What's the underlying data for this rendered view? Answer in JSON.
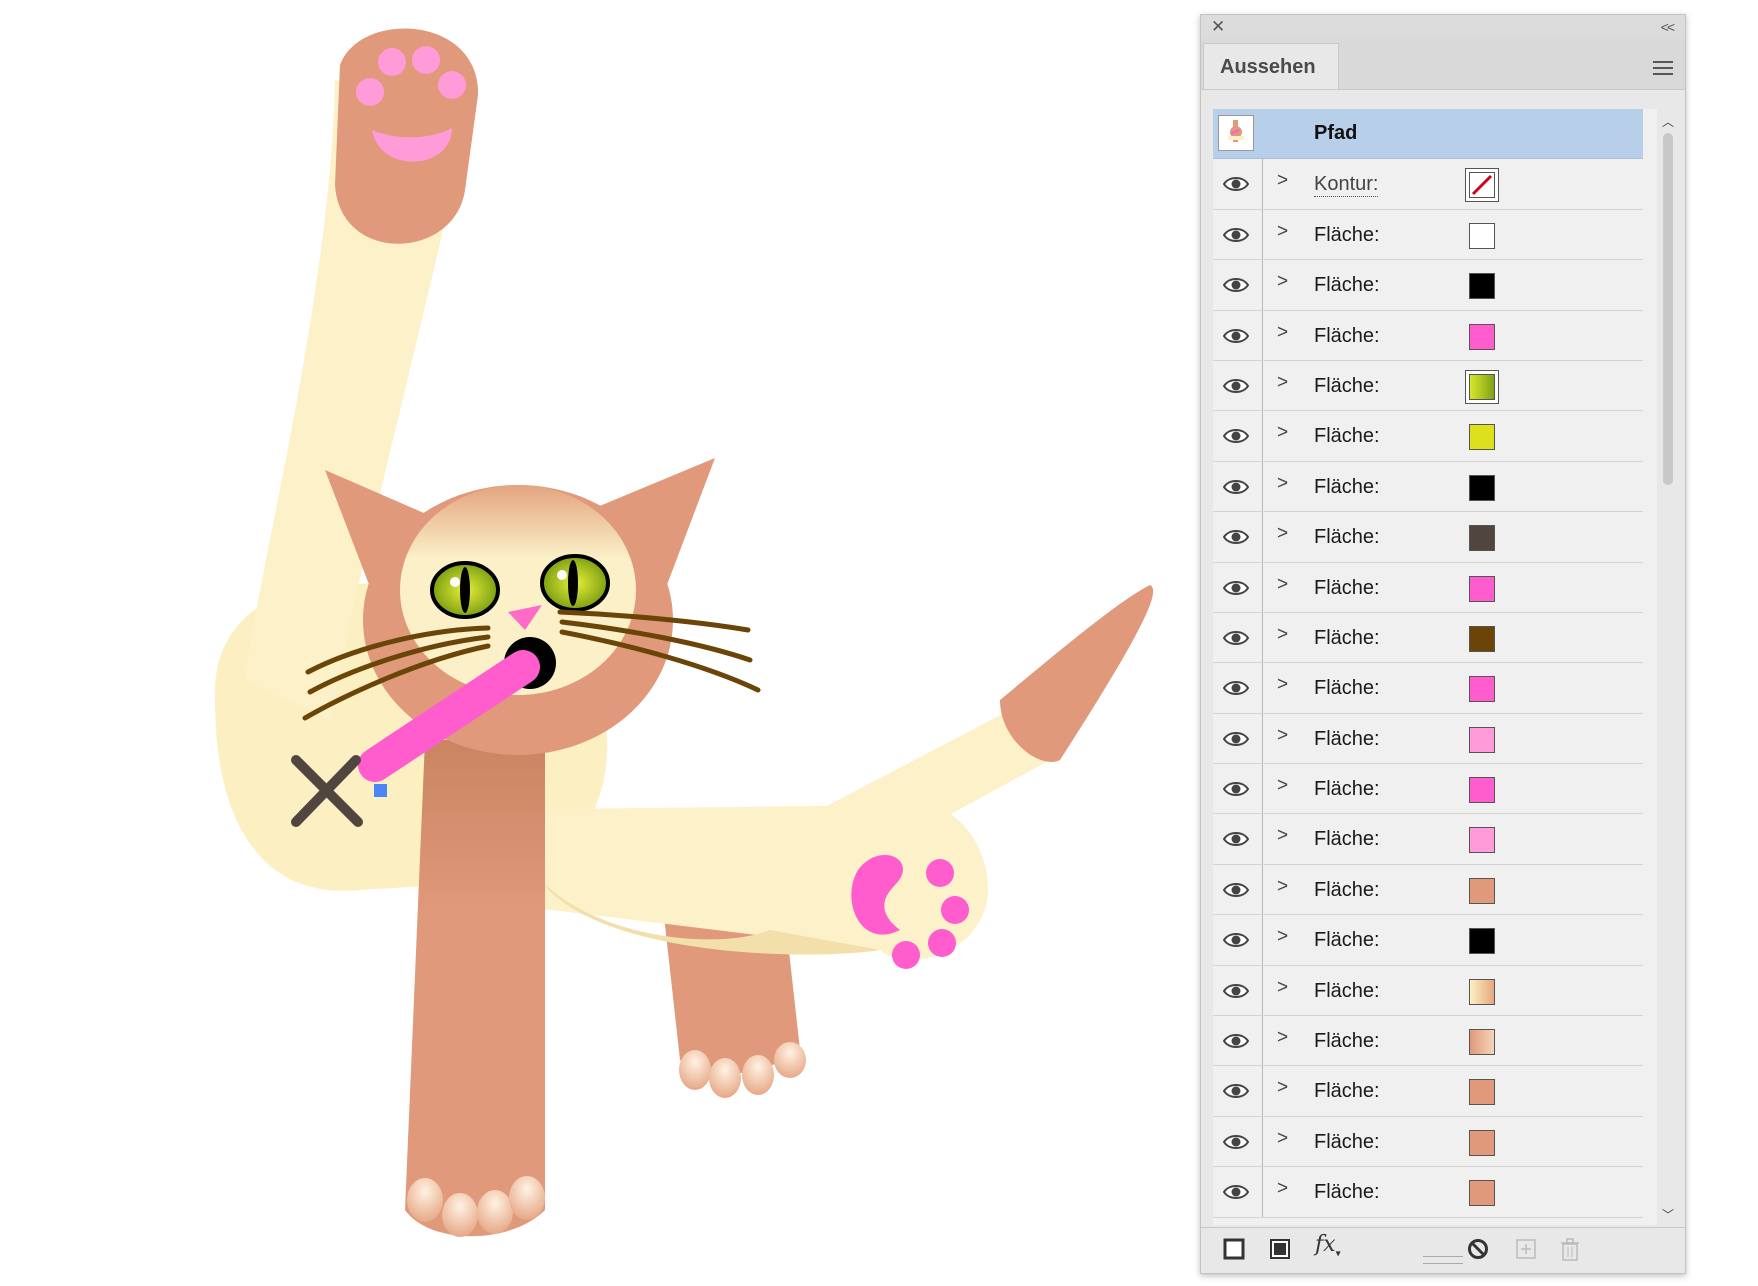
{
  "panel": {
    "tab_label": "Aussehen",
    "header_label": "Pfad",
    "stroke_label": "Kontur:",
    "rows": [
      {
        "label": "Fläche:",
        "color": "#ffffff"
      },
      {
        "label": "Fläche:",
        "color": "#000000"
      },
      {
        "label": "Fläche:",
        "color": "#ff5ccd"
      },
      {
        "label": "Fläche:",
        "color": "linear-gradient(90deg,#d8e62a,#7fa316)",
        "framed": true
      },
      {
        "label": "Fläche:",
        "color": "#dde01c"
      },
      {
        "label": "Fläche:",
        "color": "#000000"
      },
      {
        "label": "Fläche:",
        "color": "#50463f"
      },
      {
        "label": "Fläche:",
        "color": "#ff5ccd"
      },
      {
        "label": "Fläche:",
        "color": "#6b4508"
      },
      {
        "label": "Fläche:",
        "color": "#ff5ccd"
      },
      {
        "label": "Fläche:",
        "color": "#ff9bd9"
      },
      {
        "label": "Fläche:",
        "color": "#ff5ccd"
      },
      {
        "label": "Fläche:",
        "color": "#ff9bd9"
      },
      {
        "label": "Fläche:",
        "color": "#e0997a"
      },
      {
        "label": "Fläche:",
        "color": "#000000"
      },
      {
        "label": "Fläche:",
        "color": "linear-gradient(90deg,#fdf0c4,#e6a77f)"
      },
      {
        "label": "Fläche:",
        "color": "linear-gradient(90deg,#e0997a,#f5d4b8)"
      },
      {
        "label": "Fläche:",
        "color": "#e0997a"
      },
      {
        "label": "Fläche:",
        "color": "#e0997a"
      },
      {
        "label": "Fläche:",
        "color": "#e0997a"
      }
    ]
  },
  "colors": {
    "panel_bg": "#e8e8e8",
    "selected_row": "#b8cfe9",
    "cat_tan": "#e0997a",
    "cat_cream": "#fdf2c9",
    "pink": "#ff5ccd",
    "eye_green": "#c9de1c",
    "selection_handle": "#4a86f6"
  },
  "icons": [
    "close-icon",
    "collapse-icon",
    "panel-menu-icon",
    "eye-icon",
    "chevron-right-icon",
    "new-stroke-icon",
    "new-fill-icon",
    "fx-icon",
    "clear-appearance-icon",
    "duplicate-icon",
    "trash-icon"
  ]
}
